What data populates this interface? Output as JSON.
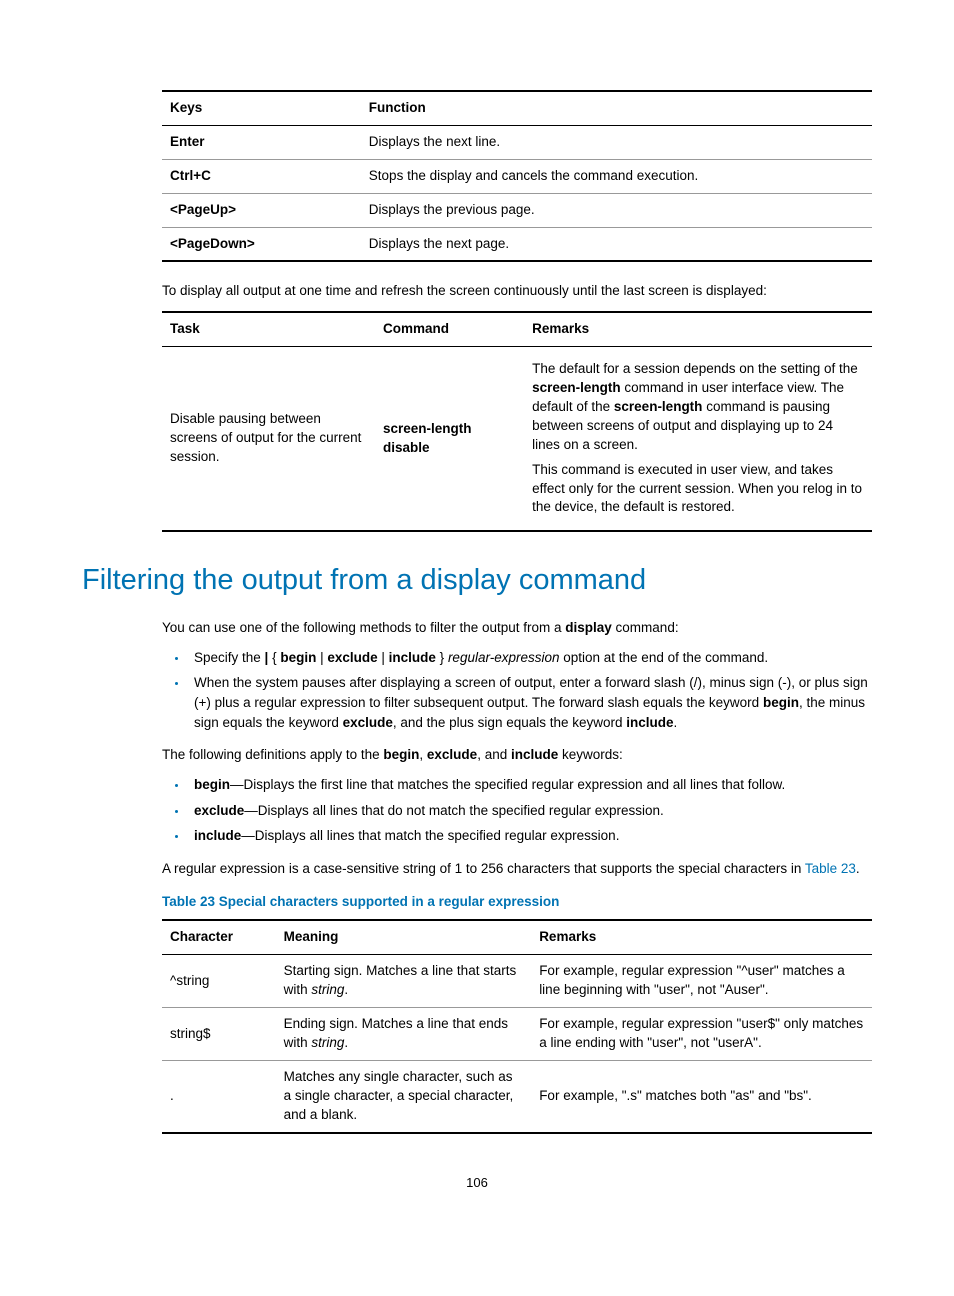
{
  "table1": {
    "headers": {
      "col1": "Keys",
      "col2": "Function"
    },
    "rows": [
      {
        "key": "Enter",
        "func": "Displays the next line."
      },
      {
        "key": "Ctrl+C",
        "func": "Stops the display and cancels the command execution."
      },
      {
        "key": "<PageUp>",
        "func": "Displays the previous page."
      },
      {
        "key": "<PageDown>",
        "func": "Displays the next page."
      }
    ]
  },
  "para1": "To display all output at one time and refresh the screen continuously until the last screen is displayed:",
  "table2": {
    "headers": {
      "col1": "Task",
      "col2": "Command",
      "col3": "Remarks"
    },
    "row": {
      "task": "Disable pausing between screens of output for the current session.",
      "command": "screen-length disable",
      "rem1a": "The default for a session depends on the setting of the ",
      "rem1b": "screen-length",
      "rem1c": " command in user interface view. The default of the ",
      "rem1d": "screen-length",
      "rem1e": " command is pausing between screens of output and displaying up to 24 lines on a screen.",
      "rem2": "This command is executed in user view, and takes effect only for the current session. When you relog in to the device, the default is restored."
    }
  },
  "heading": "Filtering the output from a display command",
  "para2a": "You can use one of the following methods to filter the output from a ",
  "para2b": "display",
  "para2c": " command:",
  "bullets1": {
    "b1a": "Specify the ",
    "b1b": "|",
    "b1c": " { ",
    "b1d": "begin",
    "b1e": " | ",
    "b1f": "exclude",
    "b1g": " | ",
    "b1h": "include",
    "b1i": " } ",
    "b1j": "regular-expression",
    "b1k": " option at the end of the command.",
    "b2a": "When the system pauses after displaying a screen of output, enter a forward slash (/), minus sign (-), or plus sign (+) plus a regular expression to filter subsequent output. The forward slash equals the keyword ",
    "b2b": "begin",
    "b2c": ", the minus sign equals the keyword ",
    "b2d": "exclude",
    "b2e": ", and the plus sign equals the keyword ",
    "b2f": "include",
    "b2g": "."
  },
  "para3a": "The following definitions apply to the ",
  "para3b": "begin",
  "para3c": ", ",
  "para3d": "exclude",
  "para3e": ", and ",
  "para3f": "include",
  "para3g": " keywords:",
  "bullets2": {
    "b1a": "begin",
    "b1b": "—Displays the first line that matches the specified regular expression and all lines that follow.",
    "b2a": "exclude",
    "b2b": "—Displays all lines that do not match the specified regular expression.",
    "b3a": "include",
    "b3b": "—Displays all lines that match the specified regular expression."
  },
  "para4a": "A regular expression is a case-sensitive string of 1 to 256 characters that supports the special characters in ",
  "para4b": "Table 23",
  "para4c": ".",
  "caption": "Table 23 Special characters supported in a regular expression",
  "table3": {
    "headers": {
      "col1": "Character",
      "col2": "Meaning",
      "col3": "Remarks"
    },
    "rows": [
      {
        "char": "^string",
        "mean_a": "Starting sign. Matches a line that starts with ",
        "mean_b": "string",
        "mean_c": ".",
        "rem": "For example, regular expression \"^user\" matches a line beginning with \"user\", not \"Auser\"."
      },
      {
        "char": "string$",
        "mean_a": "Ending sign. Matches a line that ends with ",
        "mean_b": "string",
        "mean_c": ".",
        "rem": "For example, regular expression \"user$\" only matches a line ending with \"user\", not \"userA\"."
      },
      {
        "char": ".",
        "mean_a": "Matches any single character, such as a single character, a special character, and a blank.",
        "mean_b": "",
        "mean_c": "",
        "rem": "For example, \".s\" matches both \"as\" and \"bs\"."
      }
    ]
  },
  "pagenum": "106"
}
